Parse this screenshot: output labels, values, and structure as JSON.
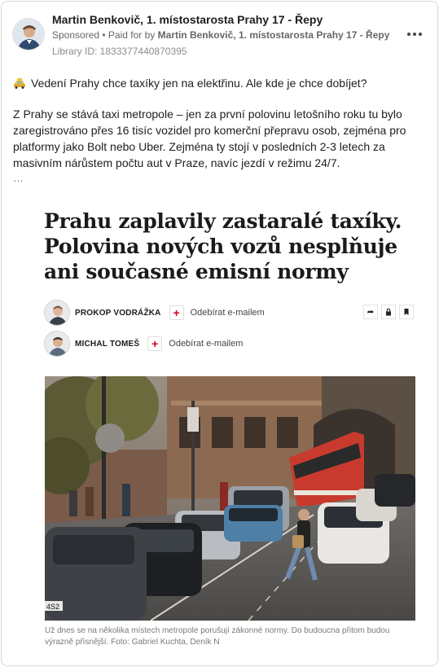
{
  "post": {
    "author": "Martin Benkovič, 1. místostarosta Prahy 17 - Řepy",
    "sponsored": "Sponsored",
    "separator": " • ",
    "paid_for_by_prefix": "Paid for by ",
    "paid_for_by_name": "Martin Benkovič, 1. místostarosta Prahy 17 - Řepy",
    "library_id": "Library ID: 1833377440870395",
    "lead_icon": "taxi-icon",
    "lead_text": "Vedení Prahy chce taxíky jen na elektřinu. Ale kde je chce dobíjet?",
    "body": "Z Prahy se stává taxi metropole – jen za první polovinu letošního roku tu bylo zaregistrováno přes 16 tisíc vozidel pro komerční přepravu osob, zejména pro platformy jako Bolt nebo Uber. Zejména ty stojí v posledních 2-3 letech za masivním nárůstem počtu aut v Praze, navíc jezdí v režimu 24/7.",
    "ellipsis": "…"
  },
  "article": {
    "headline": "Prahu zaplavily zastaralé taxíky. Polovina nových vozů nesplňuje ani současné emisní normy",
    "authors": [
      {
        "name": "PROKOP VODRÁŽKA",
        "subscribe": "Odebírat e-mailem"
      },
      {
        "name": "MICHAL TOMEŠ",
        "subscribe": "Odebírat e-mailem"
      }
    ],
    "plus": "+",
    "caption": "Už dnes se na několika místech metropole porušují zákonné normy. Do budoucna přitom budou výrazně přísnější. Foto: Gabriel Kuchta, Deník N",
    "plate": "4S2"
  }
}
